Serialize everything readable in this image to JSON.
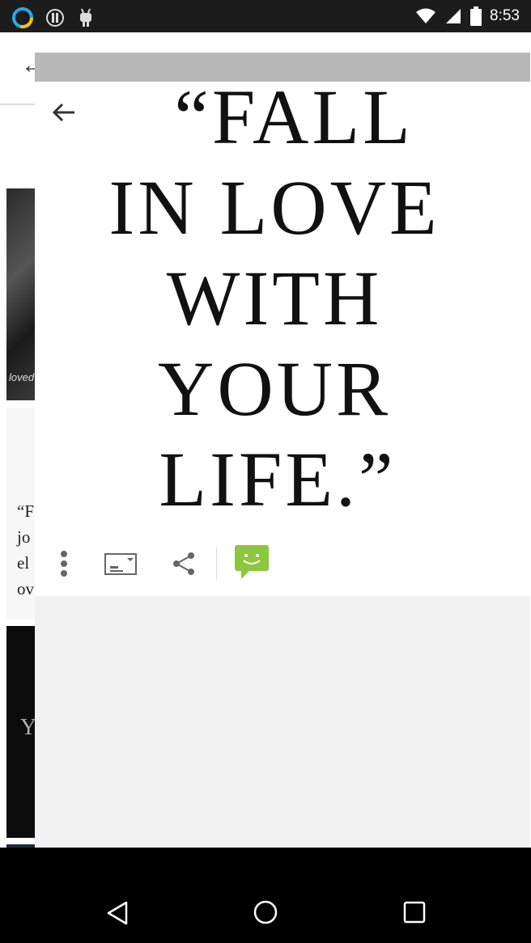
{
  "status_bar": {
    "time": "8:53",
    "icons": [
      "ring-app-icon",
      "info-icon",
      "android-icon",
      "wifi-icon",
      "signal-icon",
      "battery-icon"
    ]
  },
  "background_list": {
    "thumb_texts": [
      "loved",
      "“F",
      "jo",
      "el",
      "ov",
      "Y"
    ]
  },
  "viewer": {
    "quote_lines": [
      "“FALL",
      "IN LOVE",
      "WITH",
      "YOUR",
      "LIFE.”"
    ],
    "actions": [
      "more-vert-icon",
      "set-wallpaper-icon",
      "share-icon",
      "message-icon"
    ],
    "accent_green": "#8dc63f"
  },
  "nav_bar": {
    "buttons": [
      "back-triangle-icon",
      "home-circle-icon",
      "recents-square-icon"
    ]
  }
}
